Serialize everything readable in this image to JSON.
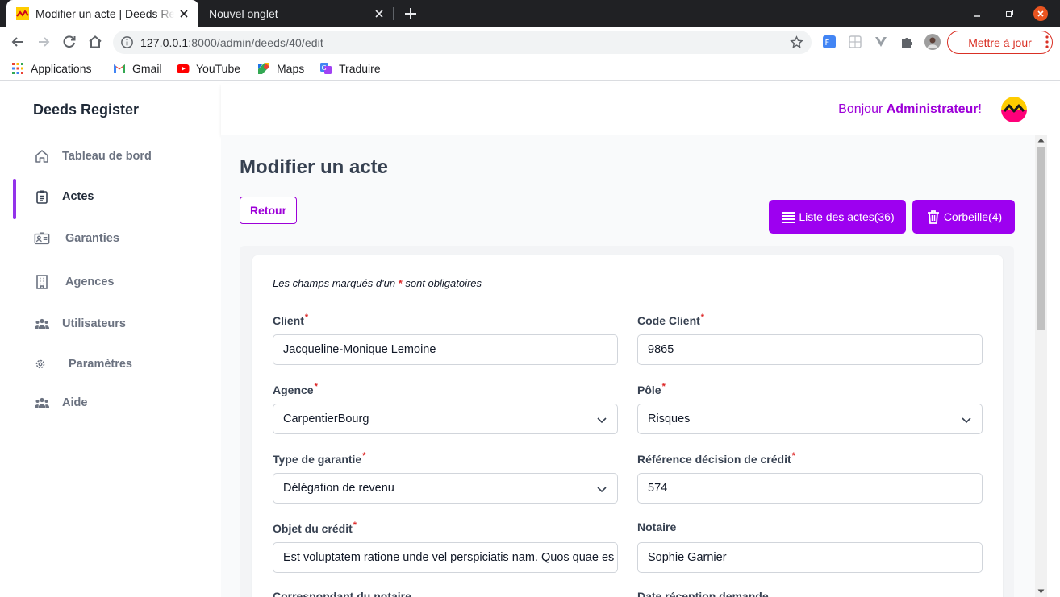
{
  "browser": {
    "tabs": [
      {
        "title": "Modifier un acte | Deeds Register",
        "active": true
      },
      {
        "title": "Nouvel onglet",
        "active": false
      }
    ],
    "url_host": "127.0.0.1",
    "url_rest": ":8000/admin/deeds/40/edit",
    "update_button": "Mettre à jour",
    "bookmarks": [
      "Applications",
      "Gmail",
      "YouTube",
      "Maps",
      "Traduire"
    ]
  },
  "app": {
    "brand": "Deeds Register",
    "greeting_prefix": "Bonjour ",
    "greeting_name": "Administrateur",
    "greeting_suffix": "!",
    "accent_color": "#9d00f0"
  },
  "sidebar": {
    "items": [
      {
        "label": "Tableau de bord",
        "icon": "home-icon"
      },
      {
        "label": "Actes",
        "icon": "clipboard-icon",
        "active": true
      },
      {
        "label": "Garanties",
        "icon": "id-card-icon"
      },
      {
        "label": "Agences",
        "icon": "building-icon"
      },
      {
        "label": "Utilisateurs",
        "icon": "users-icon"
      },
      {
        "label": "Paramètres",
        "icon": "cog-icon"
      },
      {
        "label": "Aide",
        "icon": "users-icon"
      }
    ]
  },
  "main": {
    "title": "Modifier un acte",
    "back_label": "Retour",
    "list_label": "Liste des actes(36)",
    "trash_label": "Corbeille(4)",
    "required_note_before": "Les champs marqués d'un ",
    "required_note_star": "*",
    "required_note_after": " sont obligatoires",
    "fields": [
      {
        "label": "Client",
        "required": true,
        "value": "Jacqueline-Monique Lemoine",
        "type": "text"
      },
      {
        "label": "Code Client",
        "required": true,
        "value": "9865",
        "type": "text"
      },
      {
        "label": "Agence",
        "required": true,
        "value": "CarpentierBourg",
        "type": "select"
      },
      {
        "label": "Pôle",
        "required": true,
        "value": "Risques",
        "type": "select"
      },
      {
        "label": "Type de garantie",
        "required": true,
        "value": "Délégation de revenu",
        "type": "select"
      },
      {
        "label": "Référence décision de crédit",
        "required": true,
        "value": "574",
        "type": "text"
      },
      {
        "label": "Objet du crédit",
        "required": true,
        "value": "Est voluptatem ratione unde vel perspiciatis nam. Quos quae es",
        "type": "text"
      },
      {
        "label": "Notaire",
        "required": false,
        "value": "Sophie Garnier",
        "type": "text"
      },
      {
        "label": "Correspondant du notaire",
        "required": false
      },
      {
        "label": "Date réception demande",
        "required": false
      }
    ]
  }
}
